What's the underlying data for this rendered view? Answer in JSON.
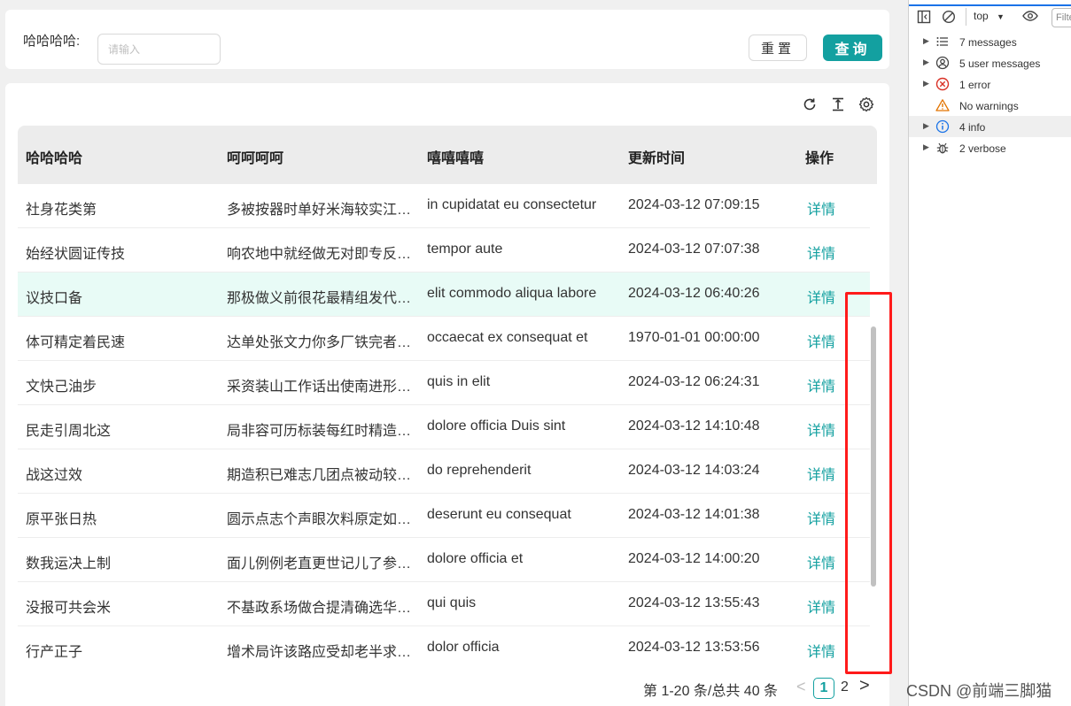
{
  "search": {
    "label": "哈哈哈哈:",
    "placeholder": "请输入",
    "reset_label": "重置",
    "query_label": "查询"
  },
  "toolbar": {
    "refresh_icon": "refresh-icon",
    "density_icon": "column-height-icon",
    "settings_icon": "gear-icon"
  },
  "table": {
    "columns": [
      "哈哈哈哈",
      "呵呵呵呵",
      "嘻嘻嘻嘻",
      "更新时间",
      "操作"
    ],
    "rows": [
      {
        "c1": "社身花类第",
        "c2": "多被按器时单好米海较实江组…",
        "c3": "in cupidatat eu consectetur",
        "c4": "2024-03-12 07:09:15",
        "action": "详情"
      },
      {
        "c1": "始经状圆证传技",
        "c2": "响农地中就经做无对即专反组…",
        "c3": "tempor aute",
        "c4": "2024-03-12 07:07:38",
        "action": "详情"
      },
      {
        "c1": "议技口备",
        "c2": "那极做义前很花最精组发代较…",
        "c3": "elit commodo aliqua labore",
        "c4": "2024-03-12 06:40:26",
        "action": "详情"
      },
      {
        "c1": "体可精定着民速",
        "c2": "达单处张文力你多厂铁完者组…",
        "c3": "occaecat ex consequat et",
        "c4": "1970-01-01 00:00:00",
        "action": "详情"
      },
      {
        "c1": "文快己油步",
        "c2": "采资装山工作话出使南进形组…",
        "c3": "quis in elit",
        "c4": "2024-03-12 06:24:31",
        "action": "详情"
      },
      {
        "c1": "民走引周北这",
        "c2": "局非容可历标装每红时精造组…",
        "c3": "dolore officia Duis sint",
        "c4": "2024-03-12 14:10:48",
        "action": "详情"
      },
      {
        "c1": "战这过效",
        "c2": "期造积已难志几团点被动较组…",
        "c3": "do reprehenderit",
        "c4": "2024-03-12 14:03:24",
        "action": "详情"
      },
      {
        "c1": "原平张日热",
        "c2": "圆示点志个声眼次料原定如组…",
        "c3": "deserunt eu consequat",
        "c4": "2024-03-12 14:01:38",
        "action": "详情"
      },
      {
        "c1": "数我运决上制",
        "c2": "面儿例例老直更世记儿了参组…",
        "c3": "dolore officia et",
        "c4": "2024-03-12 14:00:20",
        "action": "详情"
      },
      {
        "c1": "没报可共会米",
        "c2": "不基政系场做合提清确选华组…",
        "c3": "qui quis",
        "c4": "2024-03-12 13:55:43",
        "action": "详情"
      },
      {
        "c1": "行产正子",
        "c2": "增术局许该路应受却老半求组…",
        "c3": "dolor officia",
        "c4": "2024-03-12 13:53:56",
        "action": "详情"
      }
    ],
    "highlighted_row": 2
  },
  "pagination": {
    "total_text": "第 1-20 条/总共 40 条",
    "current_page": "1",
    "next_page": "2",
    "prev_symbol": "<",
    "next_symbol": ">"
  },
  "devtools": {
    "context": "top",
    "filter_placeholder": "Filter",
    "items": [
      {
        "label": "7 messages",
        "icon": "list-icon"
      },
      {
        "label": "5 user messages",
        "icon": "user-icon"
      },
      {
        "label": "1 error",
        "icon": "error-icon"
      },
      {
        "label": "No warnings",
        "icon": "warning-icon"
      },
      {
        "label": "4 info",
        "icon": "info-icon"
      },
      {
        "label": "2 verbose",
        "icon": "bug-icon"
      }
    ]
  },
  "watermark": "CSDN @前端三脚猫",
  "colors": {
    "accent": "#13a0a0",
    "highlight_row": "#e8fbf6",
    "annotation_red": "#ff1a1a",
    "error": "#d93025",
    "warning": "#e37400",
    "info": "#1a73e8"
  }
}
